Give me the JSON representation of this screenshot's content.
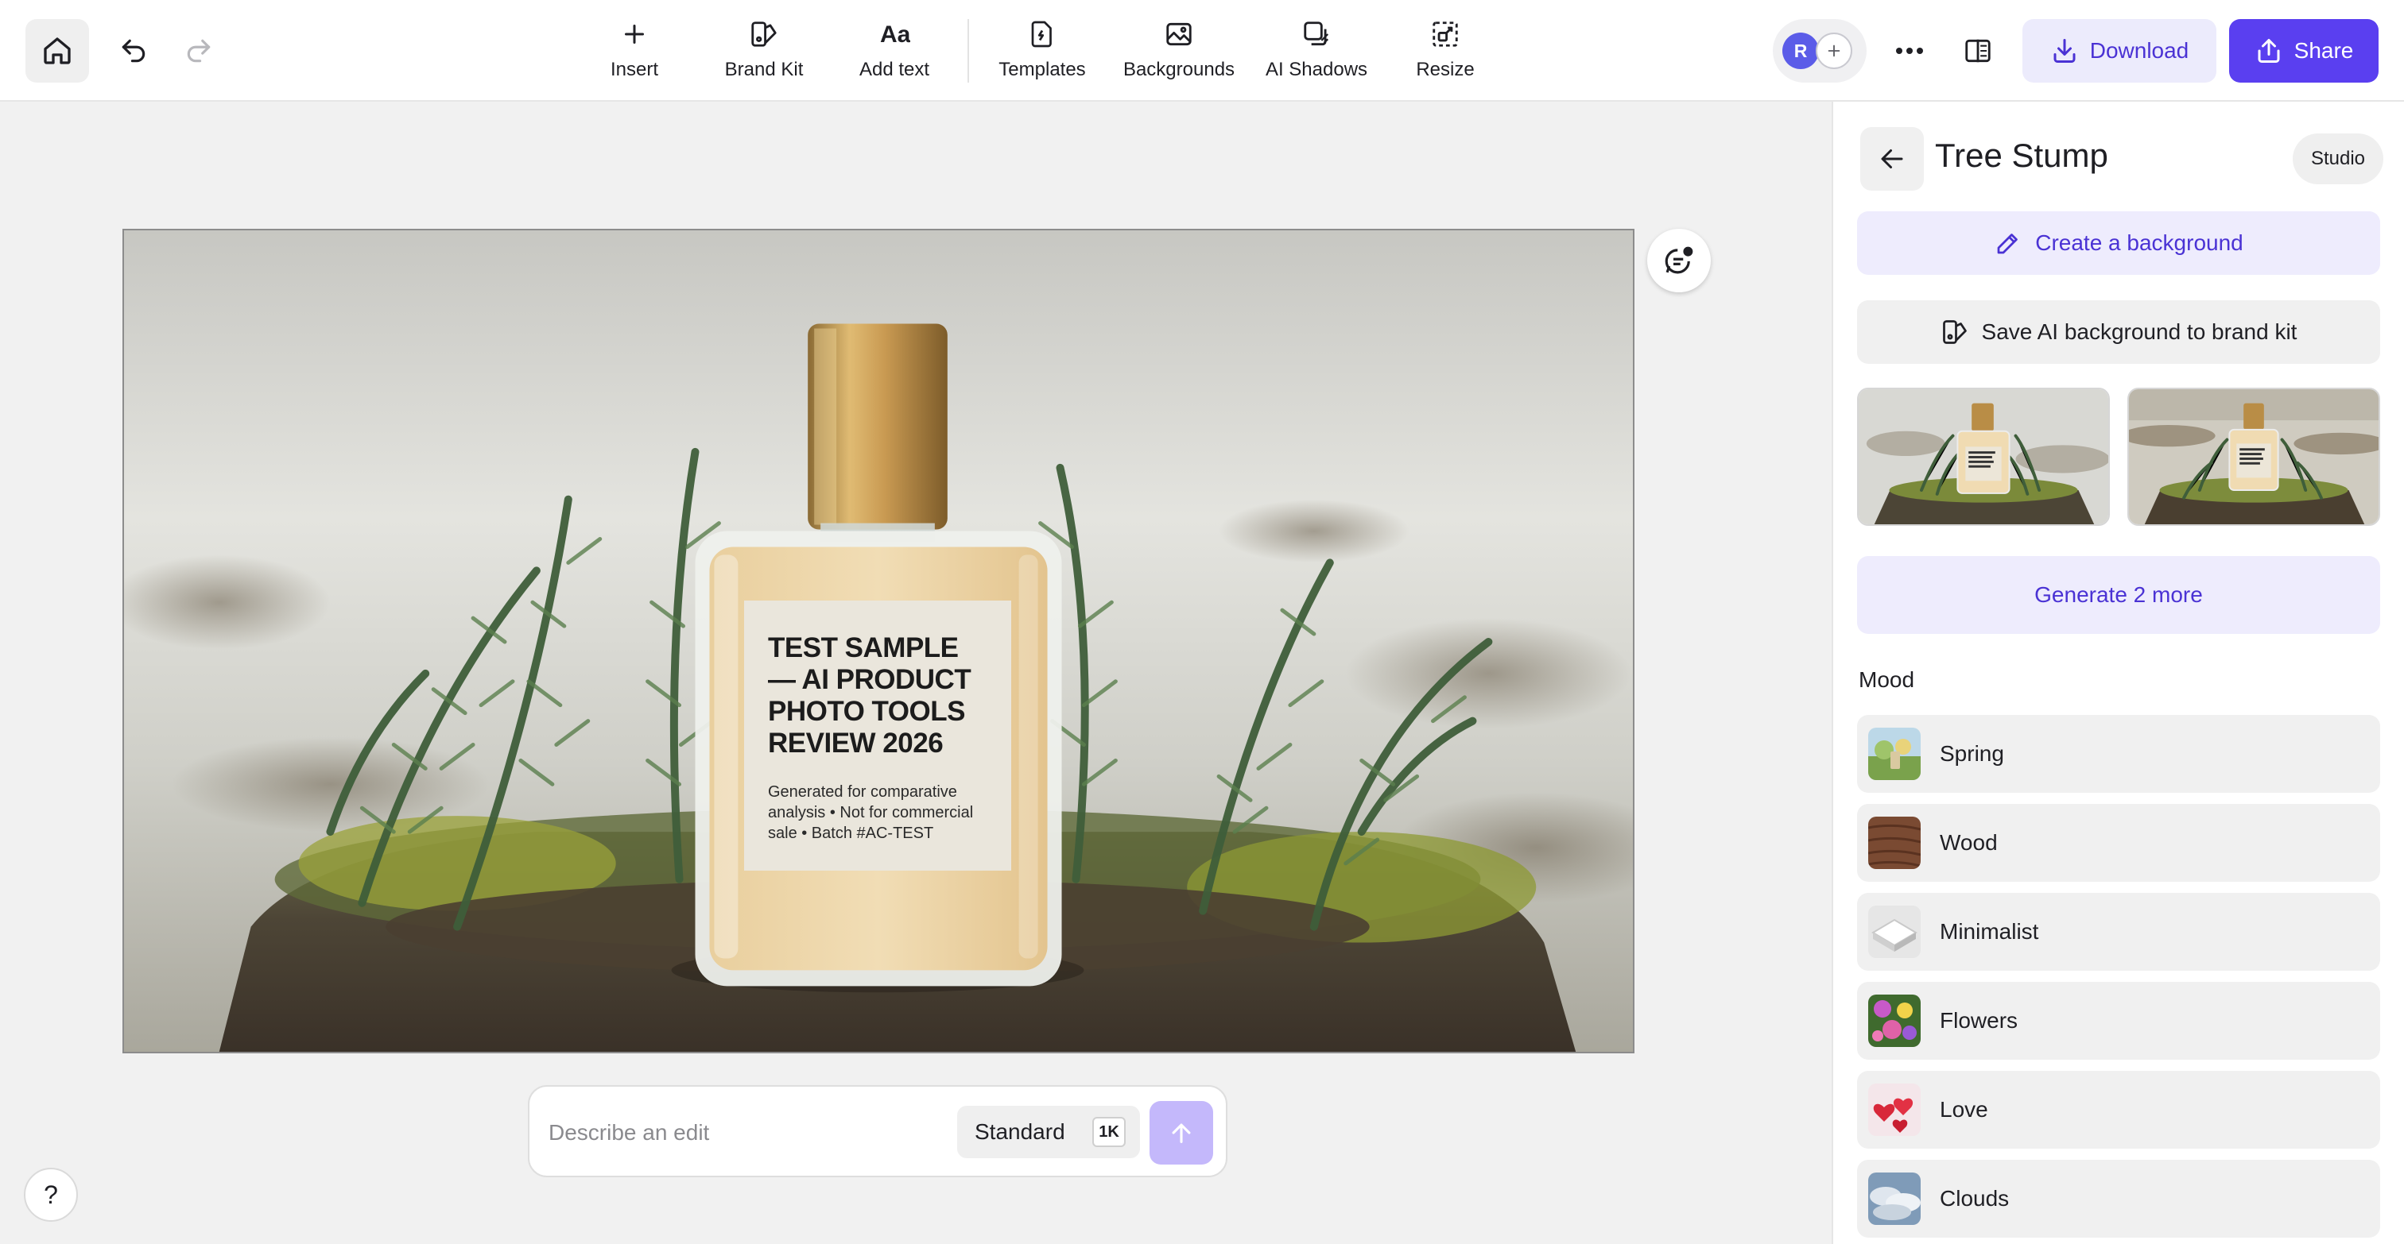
{
  "toolbar": {
    "tools": [
      {
        "label": "Insert",
        "icon": "plus-icon"
      },
      {
        "label": "Brand Kit",
        "icon": "brand-kit-icon"
      },
      {
        "label": "Add text",
        "icon": "text-aa-icon"
      },
      {
        "label": "Templates",
        "icon": "templates-icon"
      },
      {
        "label": "Backgrounds",
        "icon": "backgrounds-icon"
      },
      {
        "label": "AI Shadows",
        "icon": "ai-shadows-icon"
      },
      {
        "label": "Resize",
        "icon": "resize-icon"
      }
    ],
    "collaborator_initial": "R",
    "download_label": "Download",
    "share_label": "Share"
  },
  "canvas": {
    "label_title": "TEST SAMPLE — AI PRODUCT PHOTO TOOLS REVIEW 2026",
    "label_subtitle": "Generated for comparative analysis • Not for commercial sale • Batch #AC-TEST"
  },
  "prompt": {
    "placeholder": "Describe an edit",
    "value": "",
    "quality": "Standard",
    "resolution": "1K"
  },
  "help": {
    "label": "?"
  },
  "panel": {
    "title": "Tree Stump",
    "studio_label": "Studio",
    "create_background_label": "Create a background",
    "save_background_label": "Save AI background to brand kit",
    "generate_more_label": "Generate 2 more",
    "mood_heading": "Mood",
    "moods": [
      {
        "label": "Spring",
        "icon": "spring-thumbnail"
      },
      {
        "label": "Wood",
        "icon": "wood-thumbnail"
      },
      {
        "label": "Minimalist",
        "icon": "minimalist-thumbnail"
      },
      {
        "label": "Flowers",
        "icon": "flowers-thumbnail"
      },
      {
        "label": "Love",
        "icon": "love-hearts-thumbnail"
      },
      {
        "label": "Clouds",
        "icon": "clouds-thumbnail"
      }
    ]
  },
  "colors": {
    "accent": "#5a3ff0",
    "accent_soft": "#eeecfd",
    "accent_text": "#4a32d4"
  }
}
